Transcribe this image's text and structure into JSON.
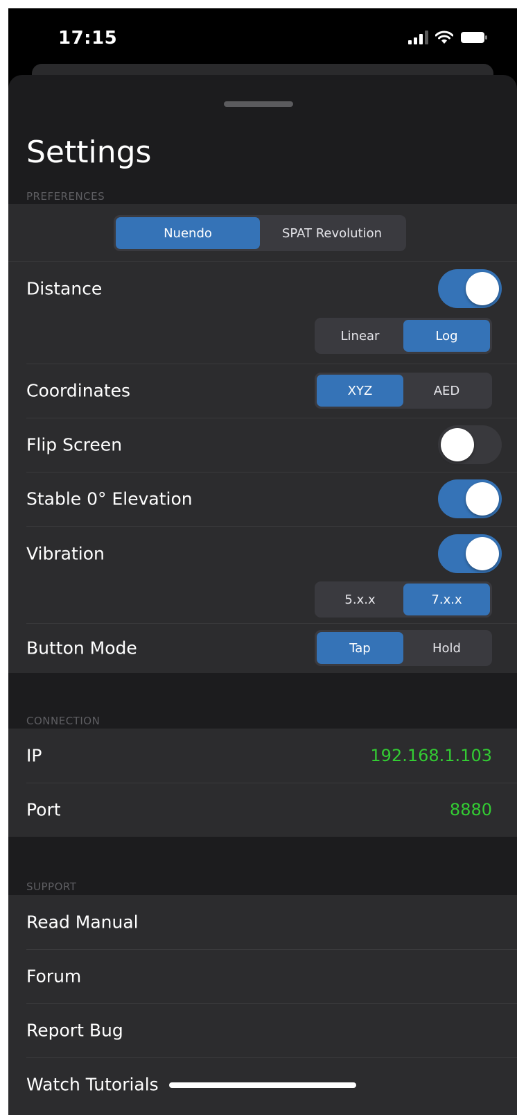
{
  "status_bar": {
    "time": "17:15",
    "icons": [
      "signal-icon",
      "wifi-icon",
      "battery-icon"
    ]
  },
  "sheet": {
    "title": "Settings"
  },
  "preferences": {
    "header": "PREFERENCES",
    "host_segment": {
      "options": [
        "Nuendo",
        "SPAT Revolution"
      ],
      "selected": "Nuendo"
    },
    "distance": {
      "label": "Distance",
      "enabled": true,
      "scale": {
        "options": [
          "Linear",
          "Log"
        ],
        "selected": "Log"
      }
    },
    "coordinates": {
      "label": "Coordinates",
      "options": [
        "XYZ",
        "AED"
      ],
      "selected": "XYZ"
    },
    "flip_screen": {
      "label": "Flip Screen",
      "enabled": false
    },
    "stable_elevation": {
      "label": "Stable 0° Elevation",
      "enabled": true
    },
    "vibration": {
      "label": "Vibration",
      "enabled": true,
      "version": {
        "options": [
          "5.x.x",
          "7.x.x"
        ],
        "selected": "7.x.x"
      }
    },
    "button_mode": {
      "label": "Button Mode",
      "options": [
        "Tap",
        "Hold"
      ],
      "selected": "Tap"
    }
  },
  "connection": {
    "header": "CONNECTION",
    "ip": {
      "label": "IP",
      "value": "192.168.1.103"
    },
    "port": {
      "label": "Port",
      "value": "8880"
    }
  },
  "support": {
    "header": "SUPPORT",
    "items": [
      "Read Manual",
      "Forum",
      "Report Bug",
      "Watch Tutorials"
    ]
  },
  "colors": {
    "accent": "#3573b7",
    "value_green": "#33cc33",
    "background": "#1c1c1e",
    "cell": "#2c2c2e"
  }
}
